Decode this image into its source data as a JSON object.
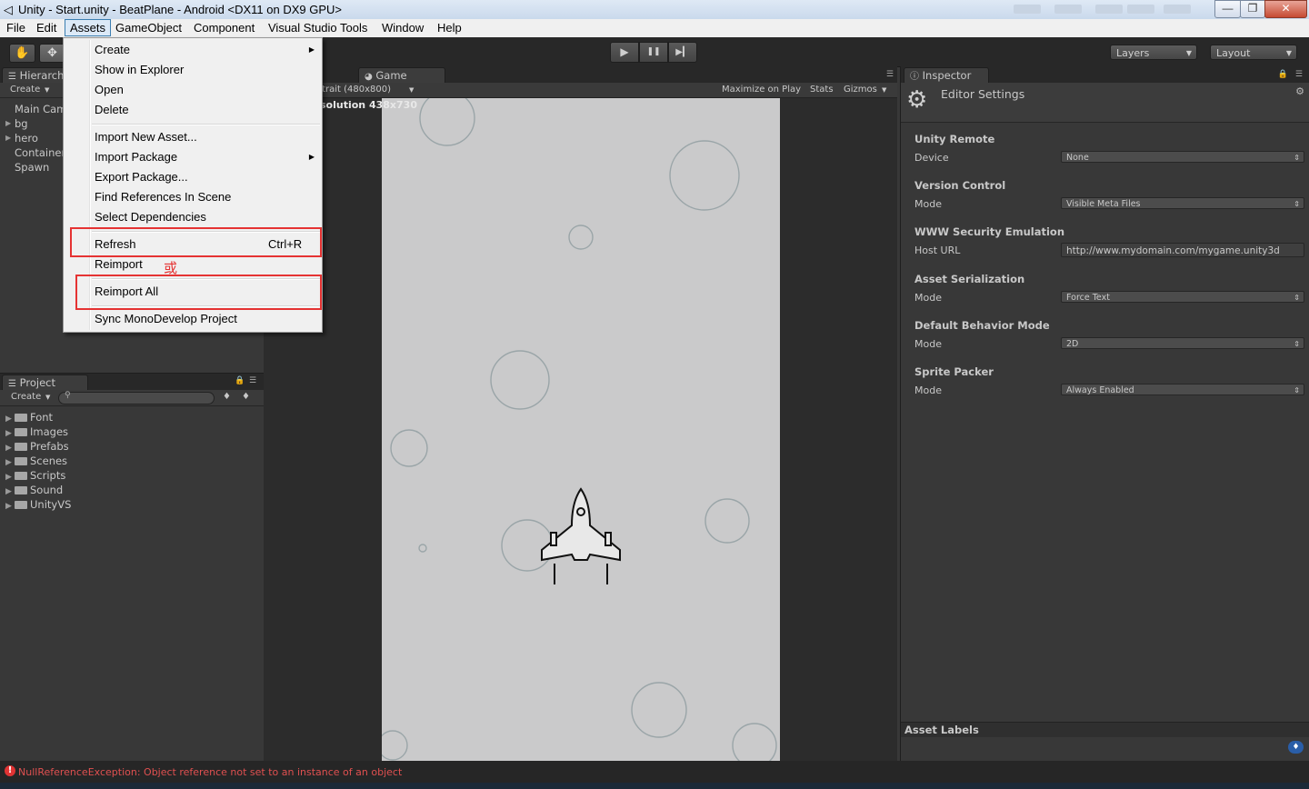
{
  "window": {
    "title": "Unity - Start.unity - BeatPlane - Android <DX11 on DX9 GPU>",
    "minimize": "—",
    "restore": "❐",
    "close": "✕"
  },
  "menubar": {
    "items": [
      "File",
      "Edit",
      "Assets",
      "GameObject",
      "Component",
      "Visual Studio Tools",
      "Window",
      "Help"
    ],
    "active": "Assets"
  },
  "assets_menu": {
    "items": [
      {
        "label": "Create",
        "submenu": true
      },
      {
        "label": "Show in Explorer"
      },
      {
        "label": "Open"
      },
      {
        "label": "Delete"
      },
      {
        "label": "Import New Asset..."
      },
      {
        "label": "Import Package",
        "submenu": true
      },
      {
        "label": "Export Package..."
      },
      {
        "label": "Find References In Scene"
      },
      {
        "label": "Select Dependencies"
      },
      {
        "label": "Refresh",
        "shortcut": "Ctrl+R"
      },
      {
        "label": "Reimport"
      },
      {
        "label": "Reimport All"
      },
      {
        "label": "Sync MonoDevelop Project"
      }
    ],
    "annotation": "或"
  },
  "toolbar": {
    "hand_tool": "✋",
    "move_tool": "✥",
    "play": "▶",
    "pause": "❚❚",
    "step": "▶▎",
    "layers": "Layers",
    "layout": "Layout"
  },
  "hierarchy": {
    "tab": "Hierarch",
    "create": "Create",
    "items": [
      "Main Cam",
      "bg",
      "hero",
      "Container",
      "Spawn"
    ]
  },
  "project": {
    "tab": "Project",
    "create": "Create",
    "search_placeholder": "",
    "folders": [
      "Font",
      "Images",
      "Prefabs",
      "Scenes",
      "Scripts",
      "Sound",
      "UnityVS"
    ]
  },
  "game": {
    "tab": "Game",
    "aspect": "rtrait (480x800)",
    "maximize": "Maximize on Play",
    "stats": "Stats",
    "gizmos": "Gizmos",
    "resolution": "solution 438x730"
  },
  "inspector": {
    "tab": "Inspector",
    "title": "Editor Settings",
    "sections": [
      {
        "header": "Unity Remote",
        "label": "Device",
        "value": "None",
        "kind": "dropdown"
      },
      {
        "header": "Version Control",
        "label": "Mode",
        "value": "Visible Meta Files",
        "kind": "dropdown"
      },
      {
        "header": "WWW Security Emulation",
        "label": "Host URL",
        "value": "http://www.mydomain.com/mygame.unity3d",
        "kind": "text"
      },
      {
        "header": "Asset Serialization",
        "label": "Mode",
        "value": "Force Text",
        "kind": "dropdown"
      },
      {
        "header": "Default Behavior Mode",
        "label": "Mode",
        "value": "2D",
        "kind": "dropdown"
      },
      {
        "header": "Sprite Packer",
        "label": "Mode",
        "value": "Always Enabled",
        "kind": "dropdown"
      }
    ],
    "asset_labels": "Asset Labels"
  },
  "status": {
    "error": "NullReferenceException: Object reference not set to an instance of an object"
  },
  "colors": {
    "highlight_box": "#e53333",
    "editor_bg": "#383838",
    "game_bg": "#cacacb"
  }
}
